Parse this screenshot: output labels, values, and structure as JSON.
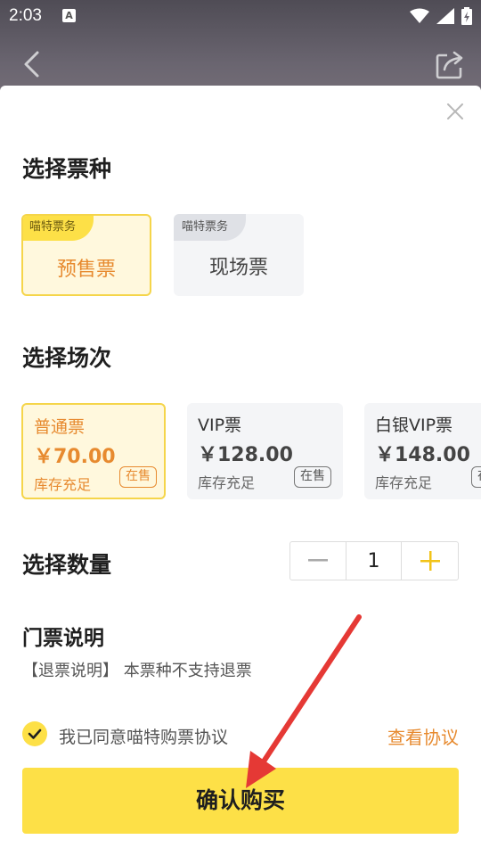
{
  "status_bar": {
    "time": "2:03",
    "a_badge": "A",
    "icons": [
      "wifi-icon",
      "signal-icon",
      "battery-charging-icon"
    ]
  },
  "nav": {
    "back_icon": "chevron-left-icon",
    "share_icon": "share-icon"
  },
  "sheet": {
    "close_icon": "close-icon",
    "ticket_type": {
      "title": "选择票种",
      "options": [
        {
          "tag": "喵特票务",
          "label": "预售票",
          "selected": true
        },
        {
          "tag": "喵特票务",
          "label": "现场票",
          "selected": false
        }
      ]
    },
    "session": {
      "title": "选择场次",
      "options": [
        {
          "name": "普通票",
          "price": "￥70.00",
          "stock": "库存充足",
          "status": "在售",
          "selected": true
        },
        {
          "name": "VIP票",
          "price": "￥128.00",
          "stock": "库存充足",
          "status": "在售",
          "selected": false
        },
        {
          "name": "白银VIP票",
          "price": "￥148.00",
          "stock": "库存充足",
          "status": "在售",
          "selected": false
        }
      ]
    },
    "quantity": {
      "title": "选择数量",
      "value": "1"
    },
    "notes": {
      "title": "门票说明",
      "text": "【退票说明】 本票种不支持退票"
    },
    "agreement": {
      "checked": true,
      "text": "我已同意喵特购票协议",
      "link": "查看协议"
    },
    "confirm_label": "确认购买"
  },
  "colors": {
    "accent_yellow": "#fde047",
    "accent_orange": "#e78a2f",
    "annotation_arrow": "#e53935"
  }
}
